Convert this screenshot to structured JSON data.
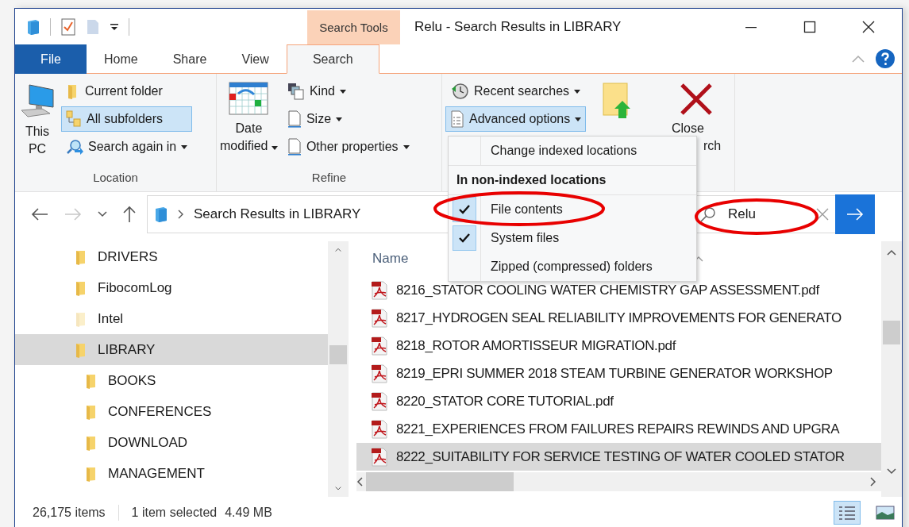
{
  "window": {
    "title": "Relu - Search Results in LIBRARY",
    "context_tab": "Search Tools"
  },
  "tabs": [
    {
      "label": "File",
      "kind": "file",
      "selected": false
    },
    {
      "label": "Home",
      "kind": "plain",
      "selected": false
    },
    {
      "label": "Share",
      "kind": "plain",
      "selected": false
    },
    {
      "label": "View",
      "kind": "plain",
      "selected": false
    },
    {
      "label": "Search",
      "kind": "context",
      "selected": true
    }
  ],
  "ribbon": {
    "location": {
      "label": "Location",
      "big_button": [
        "This",
        "PC"
      ],
      "options": [
        {
          "label": "Current folder",
          "selected": false,
          "dropdown": false
        },
        {
          "label": "All subfolders",
          "selected": true,
          "dropdown": false
        },
        {
          "label": "Search again in",
          "selected": false,
          "dropdown": true
        }
      ]
    },
    "refine": {
      "label": "Refine",
      "big_button": [
        "Date",
        "modified"
      ],
      "options": [
        {
          "label": "Kind",
          "dropdown": true
        },
        {
          "label": "Size",
          "dropdown": true
        },
        {
          "label": "Other properties",
          "dropdown": true
        }
      ]
    },
    "options": {
      "items": [
        {
          "label": "Recent searches",
          "selected": false
        },
        {
          "label": "Advanced options",
          "selected": true
        }
      ],
      "has_open_location": true
    },
    "close": {
      "big_button": [
        "Close",
        "rch"
      ]
    }
  },
  "advanced_menu": {
    "items": [
      {
        "kind": "command",
        "label": "Change indexed locations"
      },
      {
        "kind": "header",
        "label": "In non-indexed locations"
      },
      {
        "kind": "toggle",
        "label": "File contents",
        "checked": true
      },
      {
        "kind": "toggle",
        "label": "System files",
        "checked": true
      },
      {
        "kind": "toggle",
        "label": "Zipped (compressed) folders",
        "checked": false
      }
    ]
  },
  "address": {
    "path": "Search Results in LIBRARY"
  },
  "search": {
    "value": "Relu"
  },
  "nav_tree": [
    {
      "label": "DRIVERS",
      "selected": false,
      "hidden": false
    },
    {
      "label": "FibocomLog",
      "selected": false,
      "hidden": false
    },
    {
      "label": "Intel",
      "selected": false,
      "hidden": true
    },
    {
      "label": "LIBRARY",
      "selected": true,
      "hidden": false,
      "children": [
        {
          "label": "BOOKS",
          "selected": false,
          "hidden": false
        },
        {
          "label": "CONFERENCES",
          "selected": false,
          "hidden": false
        },
        {
          "label": "DOWNLOAD",
          "selected": false,
          "hidden": false
        },
        {
          "label": "MANAGEMENT",
          "selected": false,
          "hidden": false
        }
      ]
    }
  ],
  "file_list": {
    "columns": [
      "Name"
    ],
    "rows": [
      {
        "name": "8216_STATOR COOLING WATER CHEMISTRY GAP ASSESSMENT.pdf",
        "selected": false
      },
      {
        "name": "8217_HYDROGEN SEAL RELIABILITY IMPROVEMENTS FOR GENERATO",
        "selected": false
      },
      {
        "name": "8218_ROTOR AMORTISSEUR MIGRATION.pdf",
        "selected": false
      },
      {
        "name": "8219_EPRI SUMMER 2018 STEAM TURBINE GENERATOR WORKSHOP",
        "selected": false
      },
      {
        "name": "8220_STATOR CORE TUTORIAL.pdf",
        "selected": false
      },
      {
        "name": "8221_EXPERIENCES FROM FAILURES REPAIRS REWINDS AND UPGRA",
        "selected": false
      },
      {
        "name": "8222_SUITABILITY FOR SERVICE TESTING OF WATER COOLED STATOR",
        "selected": true
      }
    ]
  },
  "status_bar": {
    "count": "26,175 items",
    "selection": "1 item selected",
    "size": "4.49 MB"
  },
  "views": [
    {
      "kind": "details",
      "selected": true
    },
    {
      "kind": "thumbnails",
      "selected": false
    }
  ]
}
